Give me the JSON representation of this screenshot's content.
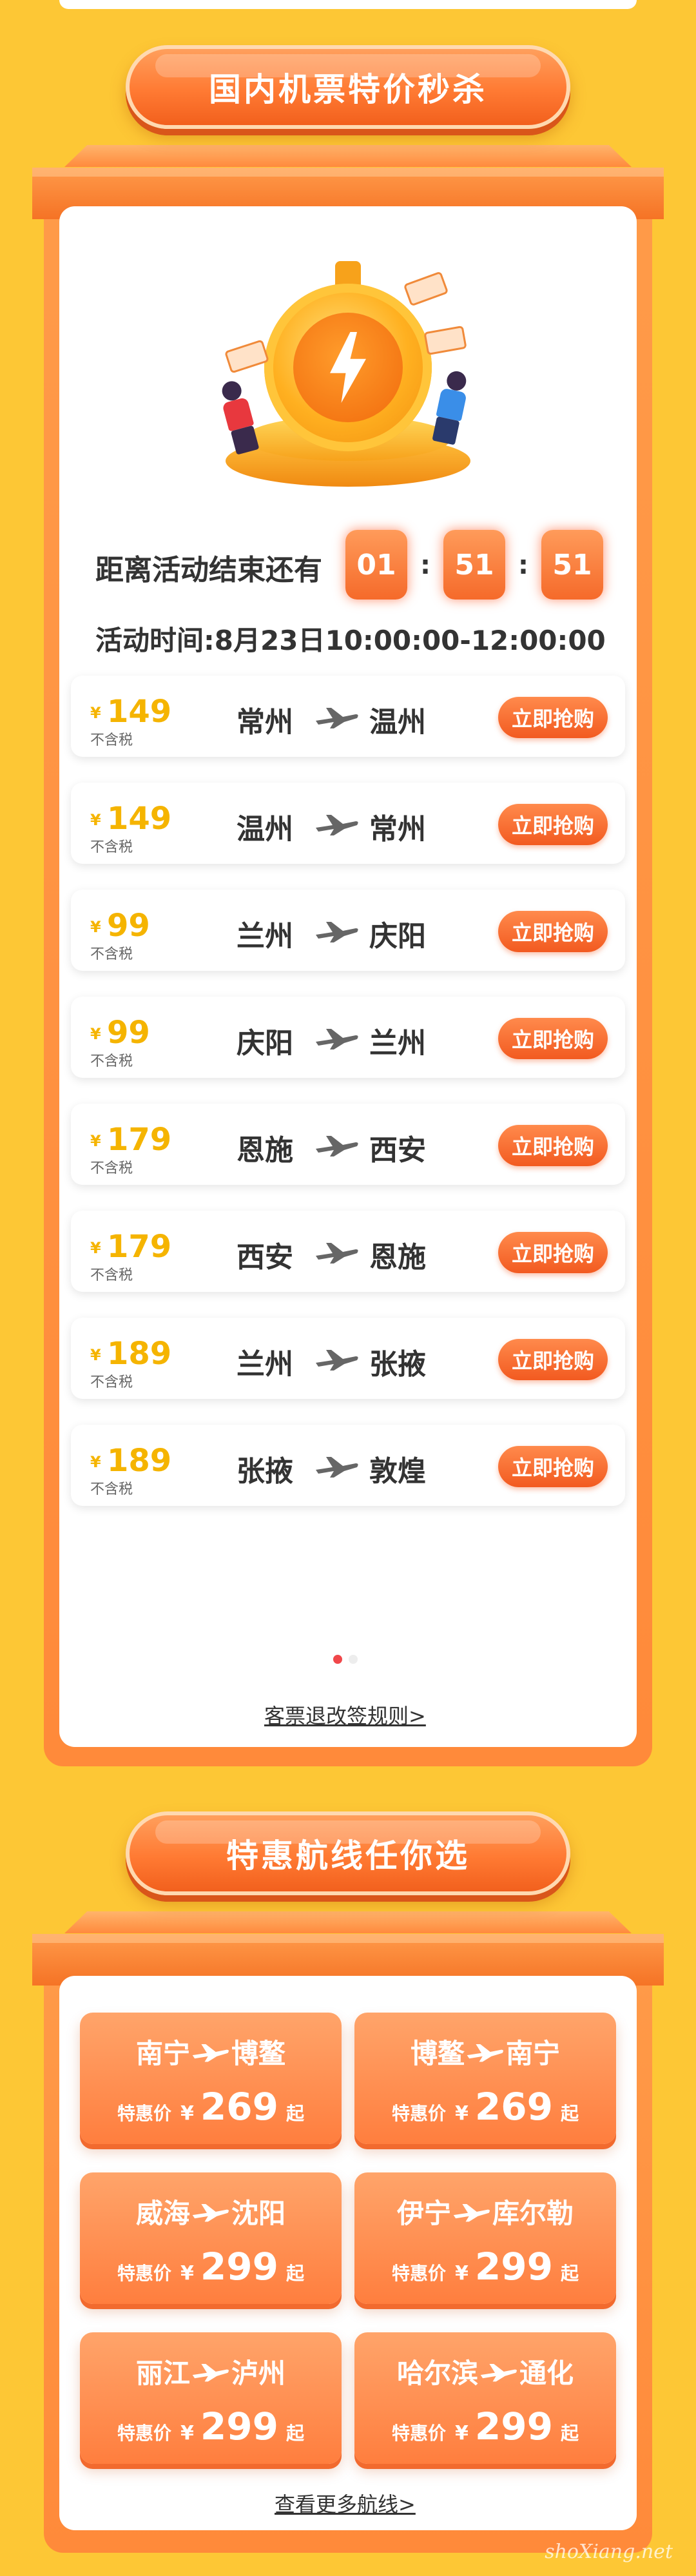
{
  "section1": {
    "title": "国内机票特价秒杀",
    "countdown": {
      "label": "距离活动结束还有",
      "hours": "01",
      "minutes": "51",
      "seconds": "51",
      "separator": ":"
    },
    "activity_time": "活动时间:8月23日10:00:00-12:00:00",
    "currency": "¥",
    "tax_note": "不含税",
    "buy_label": "立即抢购",
    "flights": [
      {
        "price": "149",
        "from": "常州",
        "to": "温州"
      },
      {
        "price": "149",
        "from": "温州",
        "to": "常州"
      },
      {
        "price": "99",
        "from": "兰州",
        "to": "庆阳"
      },
      {
        "price": "99",
        "from": "庆阳",
        "to": "兰州"
      },
      {
        "price": "179",
        "from": "恩施",
        "to": "西安"
      },
      {
        "price": "179",
        "from": "西安",
        "to": "恩施"
      },
      {
        "price": "189",
        "from": "兰州",
        "to": "张掖"
      },
      {
        "price": "189",
        "from": "张掖",
        "to": "敦煌"
      }
    ],
    "pagination": {
      "active_index": 0,
      "count": 2,
      "active_color": "#F0474A",
      "inactive_color": "#EDEDED"
    },
    "rules_link": "客票退改签规则>"
  },
  "section2": {
    "title": "特惠航线任你选",
    "deal_label": "特惠价",
    "currency": "¥",
    "suffix": "起",
    "routes": [
      {
        "from": "南宁",
        "to": "博鳌",
        "price": "269"
      },
      {
        "from": "博鳌",
        "to": "南宁",
        "price": "269"
      },
      {
        "from": "威海",
        "to": "沈阳",
        "price": "299"
      },
      {
        "from": "伊宁",
        "to": "库尔勒",
        "price": "299"
      },
      {
        "from": "丽江",
        "to": "泸州",
        "price": "299"
      },
      {
        "from": "哈尔滨",
        "to": "通化",
        "price": "299"
      }
    ],
    "more_link": "查看更多航线>"
  },
  "icons": {
    "plane": "plane-icon",
    "bolt": "lightning-bolt-icon"
  },
  "colors": {
    "background": "#FDC735",
    "accent": "#FF7A33",
    "price": "#F5B400"
  },
  "watermark": "shoXiang.net"
}
